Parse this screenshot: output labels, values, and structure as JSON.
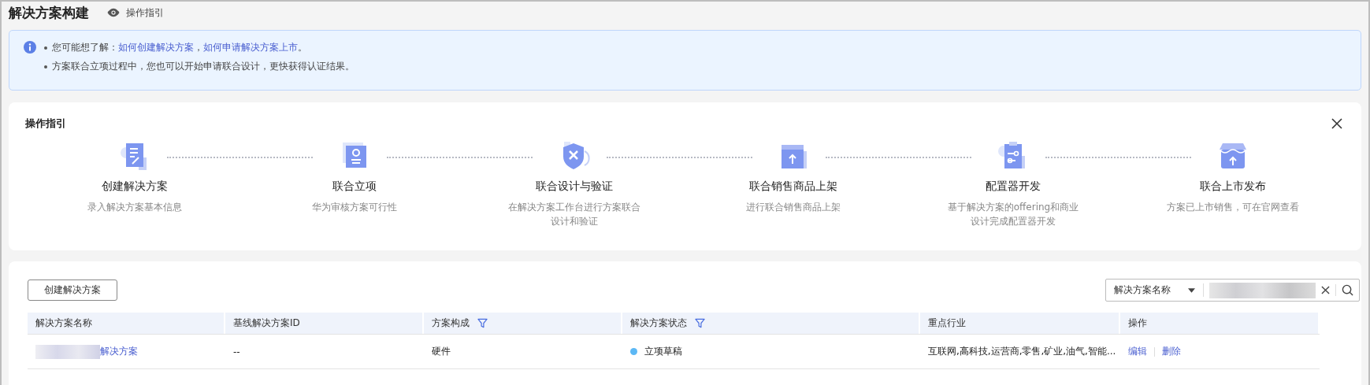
{
  "page": {
    "title": "解决方案构建",
    "guide_link": "操作指引"
  },
  "notice": {
    "lines": [
      {
        "text": "您可能想了解：",
        "links": [
          "如何创建解决方案",
          "如何申请解决方案上市"
        ],
        "separator": "，",
        "end": "。"
      },
      {
        "text": "方案联合立项过程中，您也可以开始申请联合设计，更快获得认证结果。"
      }
    ]
  },
  "guide": {
    "title": "操作指引",
    "steps": [
      {
        "kind": "document",
        "title": "创建解决方案",
        "desc_lines": [
          "录入解决方案基本信息"
        ]
      },
      {
        "kind": "stamp",
        "title": "联合立项",
        "desc_lines": [
          "华为审核方案可行性"
        ]
      },
      {
        "kind": "shield",
        "title": "联合设计与验证",
        "desc_lines": [
          "在解决方案工作台进行方案联合",
          "设计和验证"
        ]
      },
      {
        "kind": "box",
        "title": "联合销售商品上架",
        "desc_lines": [
          "进行联合销售商品上架"
        ]
      },
      {
        "kind": "clipboard",
        "title": "配置器开发",
        "desc_lines": [
          "基于解决方案的offering和商业",
          "设计完成配置器开发"
        ]
      },
      {
        "kind": "store",
        "title": "联合上市发布",
        "desc_lines": [
          "方案已上市销售，可在官网查看"
        ]
      }
    ]
  },
  "toolbar": {
    "create_button": "创建解决方案",
    "search": {
      "scope": "解决方案名称"
    }
  },
  "table": {
    "columns": [
      {
        "label": "解决方案名称",
        "filter": false
      },
      {
        "label": "基线解决方案ID",
        "filter": false
      },
      {
        "label": "方案构成",
        "filter": true
      },
      {
        "label": "解决方案状态",
        "filter": true
      },
      {
        "label": "重点行业",
        "filter": false
      },
      {
        "label": "操作",
        "filter": false
      }
    ],
    "rows": [
      {
        "name": "解决方案",
        "baseline_id": "--",
        "composition": "硬件",
        "status": "立项草稿",
        "color": "#5cb8f5",
        "industries": "互联网,高科技,运营商,零售,矿业,油气,智能...",
        "actions": [
          "编辑",
          "删除"
        ]
      }
    ]
  }
}
